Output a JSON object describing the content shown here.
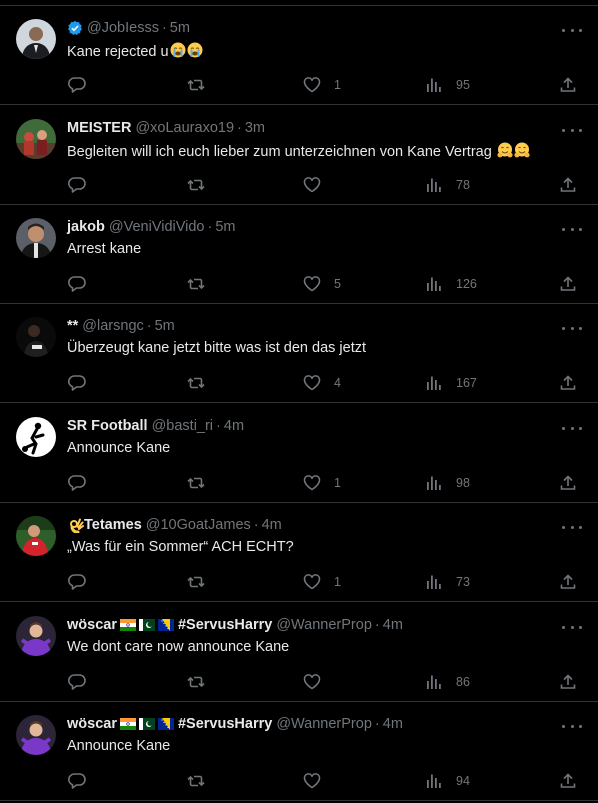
{
  "colors": {
    "background": "#000000",
    "divider": "#2f3336",
    "text_primary": "#e7e9ea",
    "text_secondary": "#71767b",
    "verified_blue": "#1d9bf0"
  },
  "icons": {
    "reply": "reply-icon",
    "retweet": "retweet-icon",
    "like": "heart-icon",
    "views": "views-icon",
    "share": "share-icon",
    "more": "more-icon",
    "verified": "verified-badge-icon"
  },
  "tweets": [
    {
      "display_name": "",
      "verified": true,
      "handle": "@JobIesss",
      "time": "5m",
      "text": "Kane rejected u",
      "emojis": [
        "loudly-crying-face-emoji",
        "loudly-crying-face-emoji"
      ],
      "likes": "1",
      "views": "95",
      "replies": "",
      "retweets": ""
    },
    {
      "display_name": "MEISTER",
      "handle": "@xoLauraxo19",
      "time": "3m",
      "text": "Begleiten will ich euch lieber zum unterzeichnen von Kane Vertrag",
      "emojis": [
        "smiling-face-with-open-hands-emoji",
        "smiling-face-with-open-hands-emoji"
      ],
      "likes": "",
      "views": "78",
      "replies": "",
      "retweets": ""
    },
    {
      "display_name": "jakob",
      "handle": "@VeniVidiVido",
      "time": "5m",
      "text": "Arrest kane",
      "likes": "5",
      "views": "126",
      "replies": "",
      "retweets": ""
    },
    {
      "display_name": "**",
      "handle": "@larsngc",
      "time": "5m",
      "text": "Überzeugt kane jetzt bitte was ist den das jetzt",
      "likes": "4",
      "views": "167",
      "replies": "",
      "retweets": ""
    },
    {
      "display_name": "SR Football",
      "handle": "@basti_ri",
      "time": "4m",
      "text": "Announce Kane",
      "likes": "1",
      "views": "98",
      "replies": "",
      "retweets": ""
    },
    {
      "display_name": "Tetames",
      "name_prefix_emoji": "ok-hand-emoji",
      "handle": "@10GoatJames",
      "time": "4m",
      "text": "„Was für ein Sommer“ ACH ECHT?",
      "likes": "1",
      "views": "73",
      "replies": "",
      "retweets": ""
    },
    {
      "display_name": "wöscar",
      "name_flags": [
        "india-flag",
        "pakistan-flag",
        "bosnia-flag"
      ],
      "name_suffix": "#ServusHarry",
      "handle": "@WannerProp",
      "time": "4m",
      "text": "We dont care now announce Kane",
      "likes": "",
      "views": "86",
      "replies": "",
      "retweets": ""
    },
    {
      "display_name": "wöscar",
      "name_flags": [
        "india-flag",
        "pakistan-flag",
        "bosnia-flag"
      ],
      "name_suffix": "#ServusHarry",
      "handle": "@WannerProp",
      "time": "4m",
      "text": "Announce Kane",
      "likes": "",
      "views": "94",
      "replies": "",
      "retweets": ""
    }
  ],
  "dot": "·"
}
